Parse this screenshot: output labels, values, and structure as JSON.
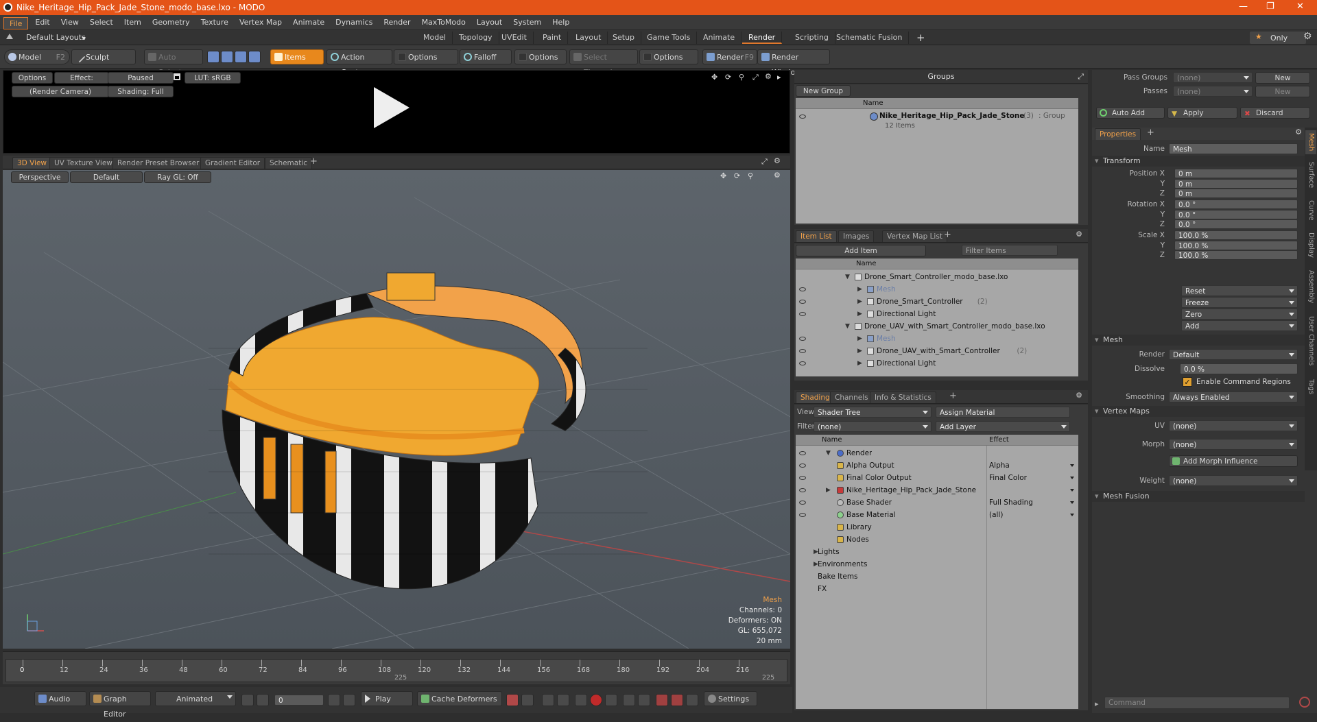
{
  "app": {
    "title": "Nike_Heritage_Hip_Pack_Jade_Stone_modo_base.lxo - MODO"
  },
  "menu": [
    "File",
    "Edit",
    "View",
    "Select",
    "Item",
    "Geometry",
    "Texture",
    "Vertex Map",
    "Animate",
    "Dynamics",
    "Render",
    "MaxToModo",
    "Layout",
    "System",
    "Help"
  ],
  "layouts": {
    "dropdown": "Default Layouts",
    "tabs": [
      "Model",
      "Topology",
      "UVEdit",
      "Paint",
      "Layout",
      "Setup",
      "Game Tools",
      "Animate",
      "Render",
      "Scripting",
      "Schematic Fusion"
    ],
    "active": "Render",
    "only": "Only"
  },
  "toolbar": {
    "model": "Model",
    "model_key": "F2",
    "sculpt": "Sculpt",
    "auto_select": "Auto Select",
    "items": "Items",
    "action_center": "Action Center",
    "options1": "Options",
    "falloff": "Falloff",
    "options2": "Options",
    "select_through": "Select Through",
    "options3": "Options",
    "render": "Render",
    "render_key": "F9",
    "render_window": "Render Window"
  },
  "render_preview": {
    "options": "Options",
    "effect": "Effect: (Shadi...",
    "paused": "Paused",
    "lut": "LUT: sRGB",
    "camera": "(Render Camera)",
    "shading": "Shading: Full"
  },
  "viewport": {
    "tabs": [
      "3D View",
      "UV Texture View",
      "Render Preset Browser",
      "Gradient Editor",
      "Schematic"
    ],
    "perspective": "Perspective",
    "default": "Default",
    "raygl": "Ray GL: Off",
    "info": {
      "mesh": "Mesh",
      "channels": "Channels: 0",
      "deformers": "Deformers: ON",
      "gl": "GL: 655,072",
      "scale": "20 mm"
    }
  },
  "timeline": {
    "ticks": [
      "0",
      "12",
      "24",
      "36",
      "48",
      "60",
      "72",
      "84",
      "96",
      "108",
      "120",
      "132",
      "144",
      "156",
      "168",
      "180",
      "192",
      "204",
      "216"
    ],
    "sub_mid": "225",
    "sub_end": "225"
  },
  "transport": {
    "audio": "Audio",
    "graph_editor": "Graph Editor",
    "animated": "Animated",
    "frame": "0",
    "play": "Play",
    "cache": "Cache Deformers",
    "settings": "Settings"
  },
  "groups": {
    "title": "Groups",
    "new_group": "New Group",
    "col_name": "Name",
    "item_name": "Nike_Heritage_Hip_Pack_Jade_Stone",
    "item_count": "(3)",
    "item_type": ": Group",
    "item_sub": "12 Items"
  },
  "item_list": {
    "tabs": [
      "Item List",
      "Images",
      "Vertex Map List"
    ],
    "add_item": "Add Item",
    "filter": "Filter Items",
    "col_name": "Name",
    "rows": [
      {
        "label": "Drone_Smart_Controller_modo_base.lxo",
        "indent": 0,
        "dim": false,
        "count": ""
      },
      {
        "label": "Mesh",
        "indent": 2,
        "dim": true,
        "count": ""
      },
      {
        "label": "Drone_Smart_Controller",
        "indent": 2,
        "dim": false,
        "count": "(2)"
      },
      {
        "label": "Directional Light",
        "indent": 2,
        "dim": false,
        "count": ""
      },
      {
        "label": "Drone_UAV_with_Smart_Controller_modo_base.lxo",
        "indent": 0,
        "dim": false,
        "count": ""
      },
      {
        "label": "Mesh",
        "indent": 2,
        "dim": true,
        "count": ""
      },
      {
        "label": "Drone_UAV_with_Smart_Controller",
        "indent": 2,
        "dim": false,
        "count": "(2)"
      },
      {
        "label": "Directional Light",
        "indent": 2,
        "dim": false,
        "count": ""
      }
    ]
  },
  "shading": {
    "tabs": [
      "Shading",
      "Channels",
      "Info & Statistics"
    ],
    "view_label": "View",
    "view_value": "Shader Tree",
    "assign": "Assign Material",
    "filter_label": "Filter",
    "filter_value": "(none)",
    "add_layer": "Add Layer",
    "col_name": "Name",
    "col_effect": "Effect",
    "rows": [
      {
        "label": "Render",
        "effect": "",
        "indent": 1
      },
      {
        "label": "Alpha Output",
        "effect": "Alpha",
        "indent": 2
      },
      {
        "label": "Final Color Output",
        "effect": "Final Color",
        "indent": 2
      },
      {
        "label": "Nike_Heritage_Hip_Pack_Jade_Stone",
        "effect": "",
        "indent": 2
      },
      {
        "label": "Base Shader",
        "effect": "Full Shading",
        "indent": 2
      },
      {
        "label": "Base Material",
        "effect": "(all)",
        "indent": 2
      },
      {
        "label": "Library",
        "effect": "",
        "indent": 1
      },
      {
        "label": "Nodes",
        "effect": "",
        "indent": 1
      },
      {
        "label": "Lights",
        "effect": "",
        "indent": 0
      },
      {
        "label": "Environments",
        "effect": "",
        "indent": 0
      },
      {
        "label": "Bake Items",
        "effect": "",
        "indent": 0
      },
      {
        "label": "FX",
        "effect": "",
        "indent": 0
      }
    ]
  },
  "properties": {
    "pass_groups": "Pass Groups",
    "passes": "Passes",
    "none": "(none)",
    "new": "New",
    "auto_add": "Auto Add",
    "apply": "Apply",
    "discard": "Discard",
    "tab": "Properties",
    "name_label": "Name",
    "name_value": "Mesh",
    "transform": "Transform",
    "position_label": "Position X",
    "rotation_label": "Rotation X",
    "scale_label": "Scale X",
    "y": "Y",
    "z": "Z",
    "position": [
      "0 m",
      "0 m",
      "0 m"
    ],
    "rotation": [
      "0.0 °",
      "0.0 °",
      "0.0 °"
    ],
    "scale": [
      "100.0 %",
      "100.0 %",
      "100.0 %"
    ],
    "reset": "Reset",
    "freeze": "Freeze",
    "zero": "Zero",
    "add": "Add",
    "mesh_section": "Mesh",
    "render_label": "Render",
    "render_value": "Default",
    "dissolve_label": "Dissolve",
    "dissolve_value": "0.0 %",
    "cmd_regions": "Enable Command Regions",
    "smoothing_label": "Smoothing",
    "smoothing_value": "Always Enabled",
    "vertex_maps": "Vertex Maps",
    "uv_label": "UV",
    "morph_label": "Morph",
    "add_morph": "Add Morph Influence",
    "weight_label": "Weight",
    "mesh_fusion": "Mesh Fusion",
    "side_tabs": [
      "Mesh",
      "Surface",
      "Curve",
      "Display",
      "Assembly",
      "User Channels",
      "Tags"
    ],
    "command": "Command"
  },
  "colors": {
    "accent": "#e0782c",
    "title_bar": "#e45418"
  }
}
